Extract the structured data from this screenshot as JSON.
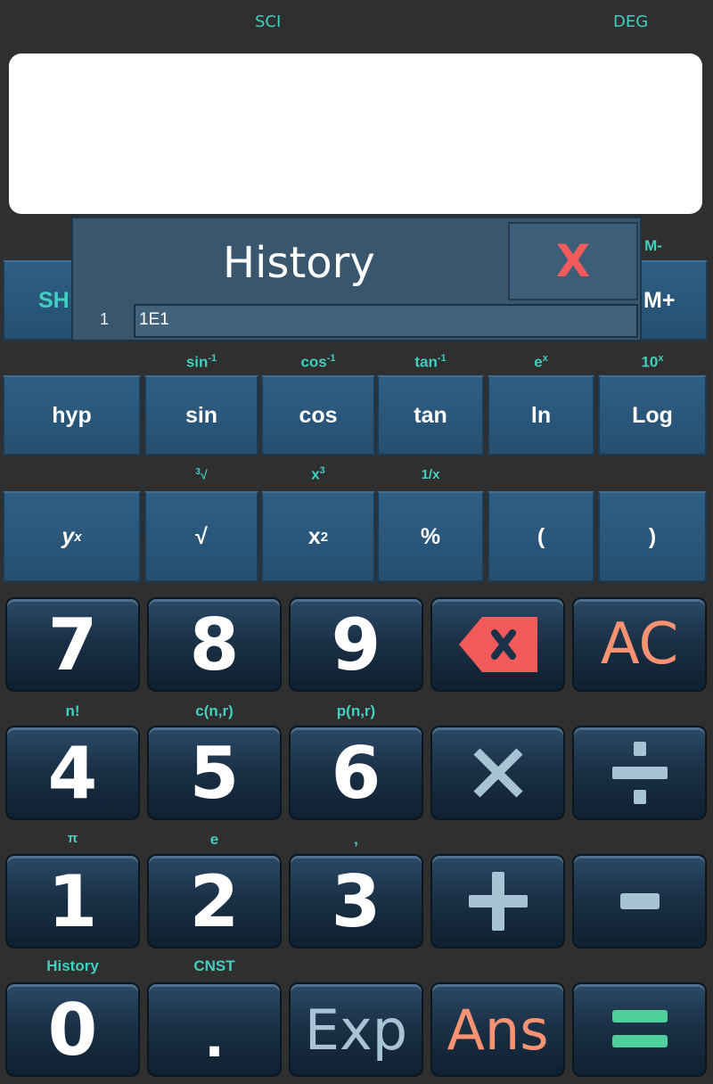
{
  "status": {
    "mode": "SCI",
    "angle": "DEG"
  },
  "display": {
    "value": ""
  },
  "history": {
    "title": "History",
    "close": "X",
    "entries": [
      {
        "index": "1",
        "expression": "1E1"
      }
    ]
  },
  "memory": {
    "partial_left": "SH",
    "m_minus": "M-",
    "m_plus": "M+"
  },
  "trig_row": {
    "secondary": [
      "sin-1",
      "cos-1",
      "tan-1",
      "ex",
      "10x"
    ],
    "buttons": [
      "hyp",
      "sin",
      "cos",
      "tan",
      "ln",
      "Log"
    ]
  },
  "power_row": {
    "secondary": [
      "3√",
      "x3",
      "1/x"
    ],
    "buttons": [
      "yx",
      "√",
      "x2",
      "%",
      "(",
      ")"
    ]
  },
  "keypad": {
    "row1": [
      "7",
      "8",
      "9",
      "backspace",
      "AC"
    ],
    "row2_secondary": [
      "n!",
      "c(n,r)",
      "p(n,r)"
    ],
    "row2": [
      "4",
      "5",
      "6",
      "X",
      "÷"
    ],
    "row3_secondary": [
      "π",
      "e",
      ","
    ],
    "row3": [
      "1",
      "2",
      "3",
      "+",
      "−"
    ],
    "row4_secondary": [
      "History",
      "CNST"
    ],
    "row4": [
      "0",
      ".",
      "Exp",
      "Ans",
      "="
    ]
  },
  "colors": {
    "accent": "#3fd0c0",
    "orange": "#f79272",
    "red": "#f25b5b",
    "equals_green": "#4fcf9c"
  }
}
